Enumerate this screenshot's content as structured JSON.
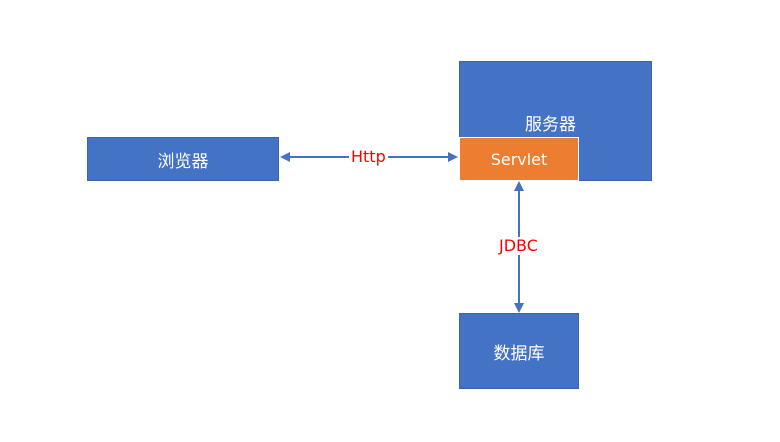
{
  "nodes": {
    "browser": "浏览器",
    "server": "服务器",
    "servlet": "Servlet",
    "database": "数据库"
  },
  "edges": {
    "http": "Http",
    "jdbc": "JDBC"
  },
  "colors": {
    "box_blue": "#4472c4",
    "servlet_orange": "#ed7d31",
    "arrow": "#4472c4",
    "edge_label": "#ff0000"
  }
}
